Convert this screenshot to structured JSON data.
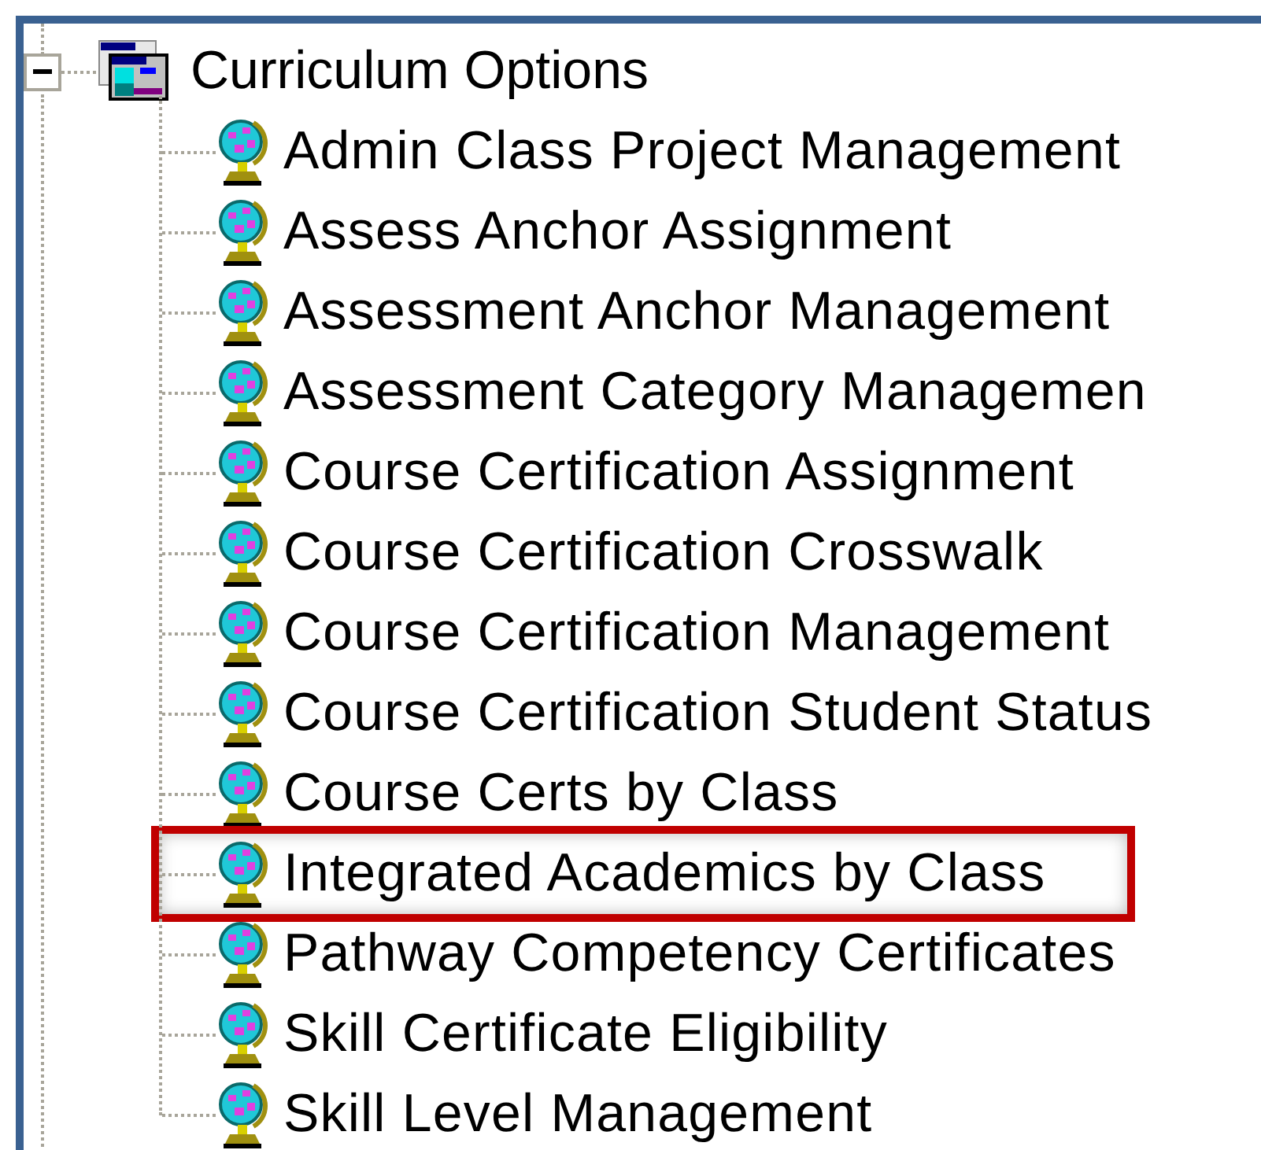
{
  "tree": {
    "label": "Curriculum Options",
    "expanded": true,
    "children": [
      {
        "label": "Admin Class Project Management",
        "highlighted": false
      },
      {
        "label": "Assess Anchor Assignment",
        "highlighted": false
      },
      {
        "label": "Assessment Anchor Management",
        "highlighted": false
      },
      {
        "label": "Assessment Category Managemen",
        "highlighted": false
      },
      {
        "label": "Course Certification Assignment",
        "highlighted": false
      },
      {
        "label": "Course Certification Crosswalk",
        "highlighted": false
      },
      {
        "label": "Course Certification Management",
        "highlighted": false
      },
      {
        "label": "Course Certification Student Status",
        "highlighted": false
      },
      {
        "label": "Course Certs by Class",
        "highlighted": false
      },
      {
        "label": "Integrated Academics by Class",
        "highlighted": true
      },
      {
        "label": "Pathway Competency Certificates",
        "highlighted": false
      },
      {
        "label": "Skill Certificate Eligibility",
        "highlighted": false
      },
      {
        "label": "Skill Level Management",
        "highlighted": false
      }
    ]
  }
}
